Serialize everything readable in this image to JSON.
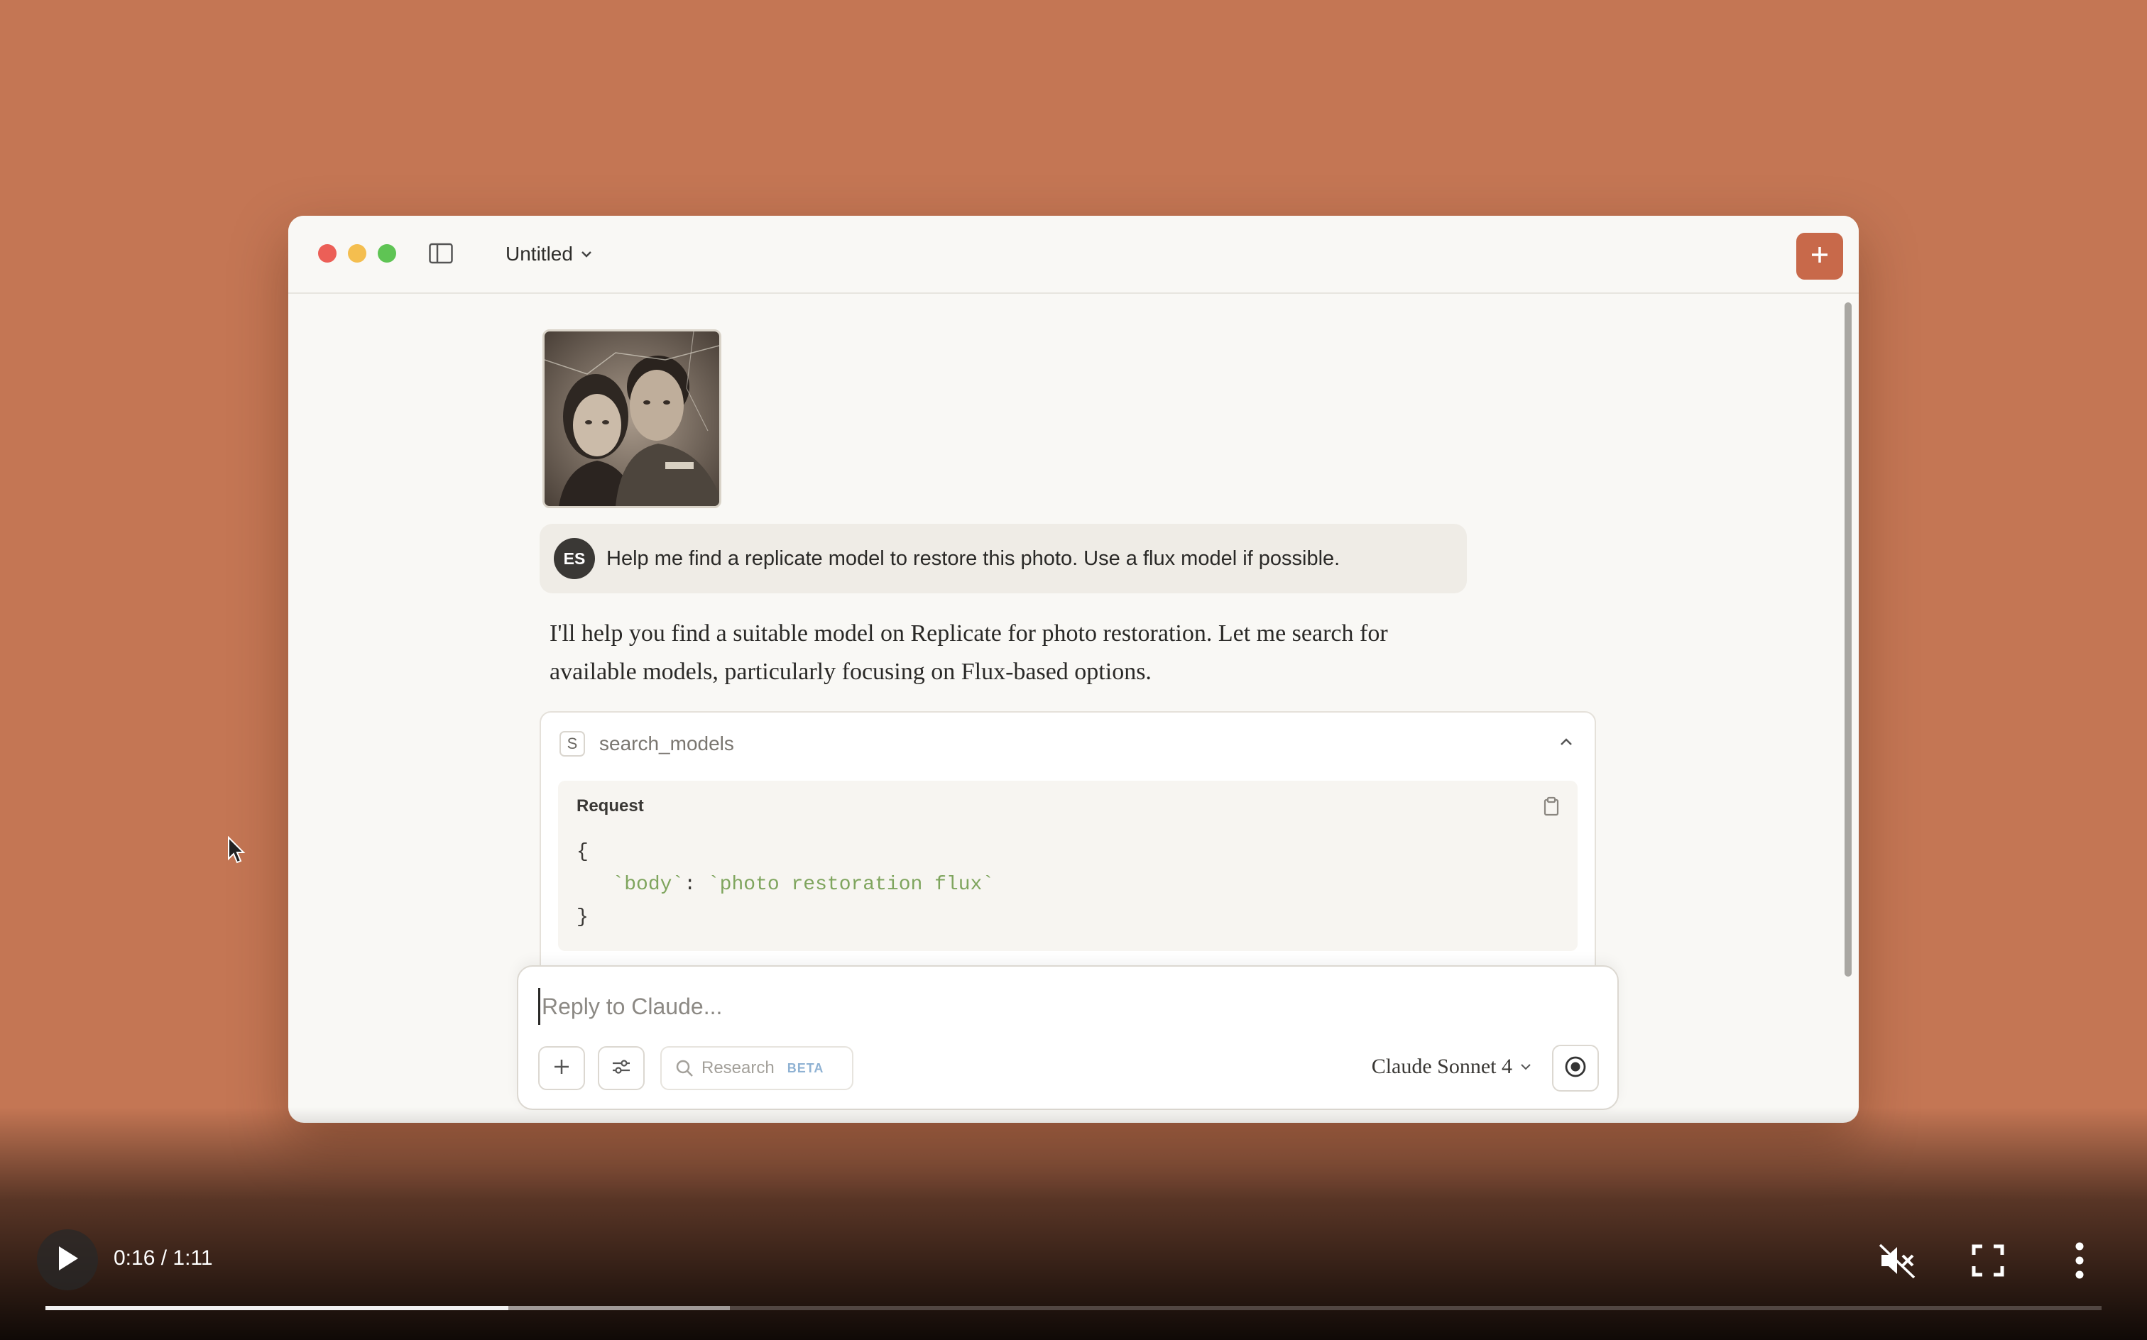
{
  "window": {
    "title": "Untitled"
  },
  "conversation": {
    "user_initials": "ES",
    "user_message": "Help me find a replicate model to restore this photo. Use a flux model if possible.",
    "assistant_line1": "I'll help you find a suitable model on Replicate for photo restoration. Let me search for",
    "assistant_line2": "available models, particularly focusing on Flux-based options.",
    "tool_call": {
      "badge": "S",
      "name": "search_models",
      "request_label": "Request",
      "code_open": "{",
      "code_key": "`body`",
      "code_colon": ": ",
      "code_value": "`photo restoration flux`",
      "code_close": "}"
    }
  },
  "composer": {
    "placeholder": "Reply to Claude...",
    "research_label": "Research",
    "research_badge": "BETA",
    "model": "Claude Sonnet 4"
  },
  "video": {
    "current_time": "0:16",
    "duration": "1:11",
    "time_display": "0:16 / 1:11",
    "played_fraction": 0.225,
    "buffered_fraction": 0.333
  },
  "colors": {
    "background": "#c47654",
    "accent": "#c8694a"
  }
}
